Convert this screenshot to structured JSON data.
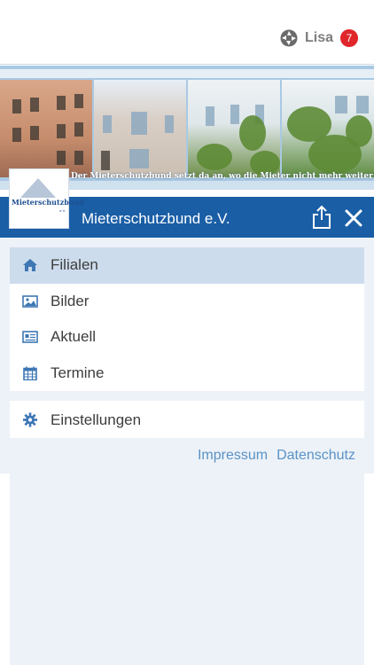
{
  "header": {
    "user_name": "Lisa",
    "notification_count": "7"
  },
  "banner": {
    "caption": "Der Mieterschutzbund setzt da an, wo die Mieter nicht mehr weiter wissen."
  },
  "logo": {
    "text": "Mieterschutzbund",
    "sub": "e.V."
  },
  "titlebar": {
    "title": "Mieterschutzbund e.V."
  },
  "menu": {
    "items": [
      {
        "label": "Filialen",
        "icon": "home-icon"
      },
      {
        "label": "Bilder",
        "icon": "image-icon"
      },
      {
        "label": "Aktuell",
        "icon": "news-icon"
      },
      {
        "label": "Termine",
        "icon": "calendar-icon"
      }
    ],
    "settings_label": "Einstellungen",
    "settings_icon": "gear-icon"
  },
  "footer_links": {
    "impressum": "Impressum",
    "datenschutz": "Datenschutz"
  },
  "colors": {
    "titlebar": "#1a5ea6",
    "accent_link": "#5a92c6",
    "active_item": "#cddcec",
    "badge": "#e0262b",
    "menu_bg": "#edf2f8"
  }
}
